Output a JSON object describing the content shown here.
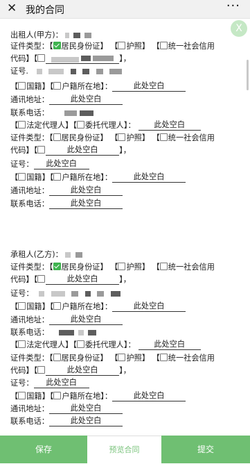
{
  "header": {
    "close_glyph": "✕",
    "title": "我的合同",
    "more_glyph": "···"
  },
  "fab_close_glyph": "X",
  "lessor": {
    "heading": "出租人(甲方)：",
    "id_type_label": "证件类型：",
    "opt_id_card": "居民身份证】",
    "opt_passport": "护照】",
    "opt_unified_code_a": "统一社会信用",
    "opt_unified_code_b": "代码】【",
    "end_bracket": "】，",
    "id_no_label": "证号.",
    "opt_nationality": "国籍】【",
    "opt_household": "户籍所在地】：",
    "blank_value": "此处空白",
    "address_label": "通讯地址：",
    "phone_label": "联系电话：",
    "agent_legal": "法定代理人】【",
    "agent_entrusted": "委托代理人】：",
    "agent_id_type_label": "证件类型：",
    "agent_id_no_label": "证号：",
    "agent_address_label": "通讯地址：",
    "agent_phone_label": "联系电话："
  },
  "lessee": {
    "heading": "承租人(乙方)：",
    "id_type_label": "证件类型：",
    "opt_id_card": "居民身份证】",
    "opt_passport": "护照】",
    "opt_unified_code_a": "统一社会信用",
    "opt_unified_code_b": "代码】【",
    "end_bracket": "】，",
    "id_no_label": "证号：",
    "opt_nationality": "国籍】【",
    "opt_household": "户籍所在地】：",
    "blank_value": "此处空白",
    "address_label": "通讯地址：",
    "phone_label": "联系电话：",
    "agent_legal": "法定代理人】【",
    "agent_entrusted": "委托代理人】：",
    "agent_id_type_label": "证件类型：",
    "agent_id_no_label": "证号：",
    "agent_address_label": "通讯地址：",
    "agent_phone_label": "联系电话："
  },
  "bracket_open": "【",
  "bottom": {
    "save": "保存",
    "preview": "预览合同",
    "submit": "提交"
  }
}
